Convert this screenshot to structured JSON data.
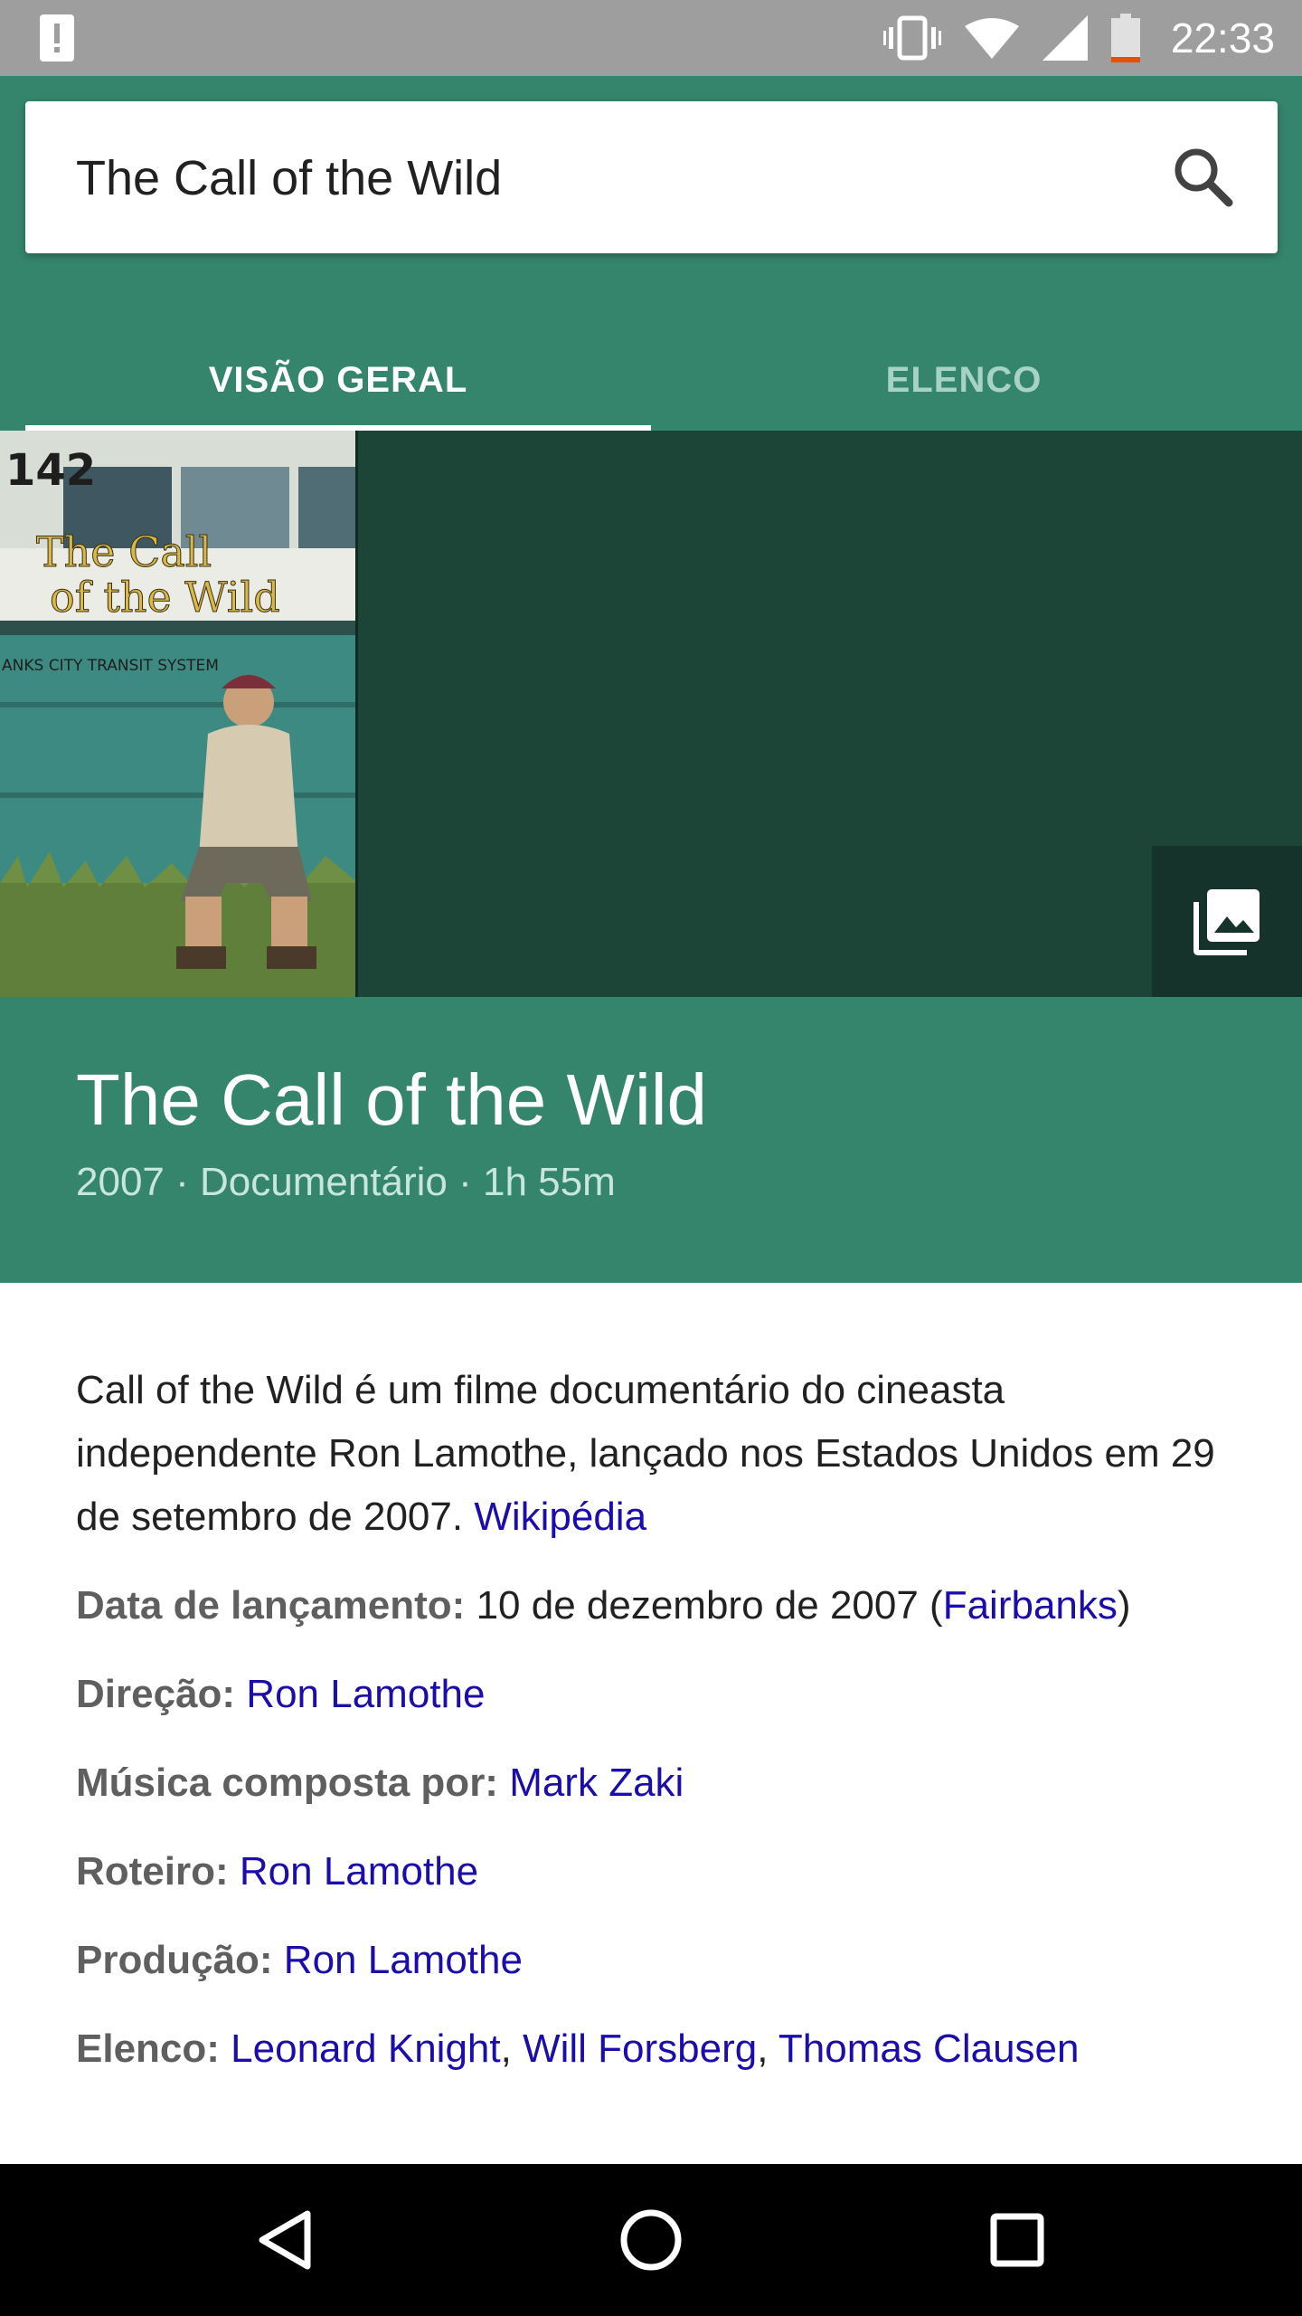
{
  "status_bar": {
    "time": "22:33",
    "icons": [
      "alert-icon",
      "vibrate-icon",
      "wifi-icon",
      "signal-icon",
      "battery-low-icon"
    ]
  },
  "search": {
    "query": "The Call of the Wild"
  },
  "tabs": [
    {
      "label": "VISÃO GERAL",
      "active": true
    },
    {
      "label": "ELENCO",
      "active": false
    }
  ],
  "poster": {
    "bus_number": "142",
    "title_line1": "The Call",
    "title_line2": "of the Wild",
    "bus_text": "ANKS CITY TRANSIT SYSTEM"
  },
  "movie": {
    "title": "The Call of the Wild",
    "meta": "2007 · Documentário · 1h 55m",
    "summary": "Call of the Wild é um filme documentário do cineasta independente Ron Lamothe, lançado nos Estados Unidos em 29 de setembro de 2007.",
    "summary_source": "Wikipédia"
  },
  "details": {
    "release": {
      "key": "Data de lançamento:",
      "value": "10 de dezembro de 2007 (",
      "link": "Fairbanks",
      "suffix": ")"
    },
    "director": {
      "key": "Direção:",
      "link": "Ron Lamothe"
    },
    "music": {
      "key": "Música composta por:",
      "link": "Mark Zaki"
    },
    "screenplay": {
      "key": "Roteiro:",
      "link": "Ron Lamothe"
    },
    "production": {
      "key": "Produção:",
      "link": "Ron Lamothe"
    },
    "cast": {
      "key": "Elenco:",
      "links": [
        "Leonard Knight",
        "Will Forsberg",
        "Thomas Clausen"
      ],
      "separator": ", "
    }
  },
  "colors": {
    "header_green": "#35846c",
    "hero_dark": "#1c4538",
    "link_blue": "#1a0dab",
    "status_gray": "#9e9e9e"
  }
}
